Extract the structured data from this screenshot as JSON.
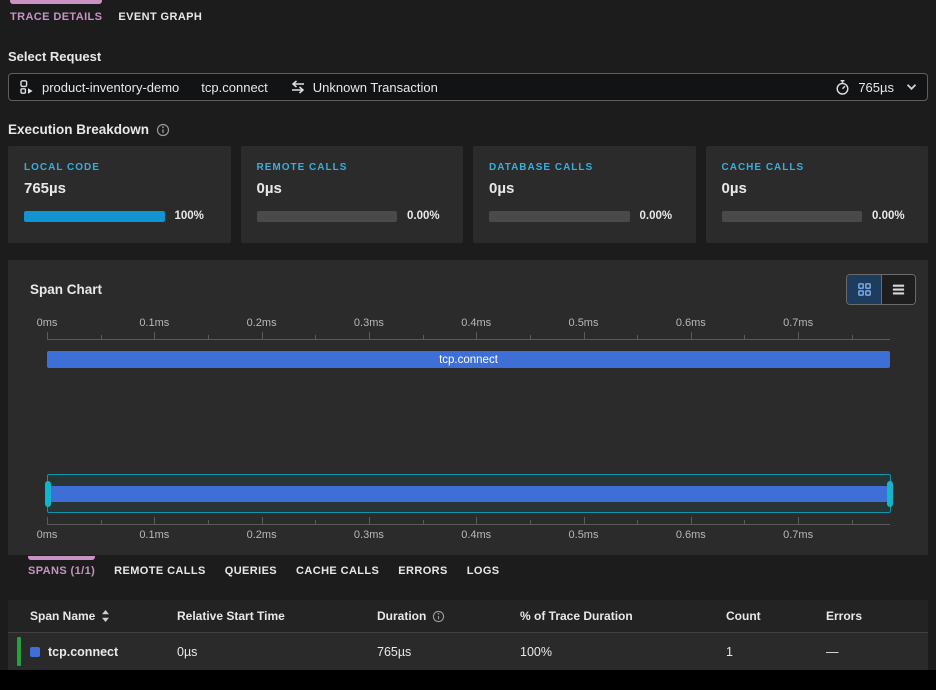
{
  "top_tabs": {
    "items": [
      {
        "label": "TRACE DETAILS",
        "active": true
      },
      {
        "label": "EVENT GRAPH",
        "active": false
      }
    ]
  },
  "select_request": {
    "heading": "Select Request",
    "service_name": "product-inventory-demo",
    "span_name": "tcp.connect",
    "transaction_name": "Unknown Transaction",
    "trace_duration": "765µs"
  },
  "execution_breakdown": {
    "heading": "Execution Breakdown",
    "cards": [
      {
        "label": "LOCAL CODE",
        "value": "765µs",
        "percent": "100%",
        "fill_pct": 100
      },
      {
        "label": "REMOTE CALLS",
        "value": "0µs",
        "percent": "0.00%",
        "fill_pct": 0
      },
      {
        "label": "DATABASE CALLS",
        "value": "0µs",
        "percent": "0.00%",
        "fill_pct": 0
      },
      {
        "label": "CACHE CALLS",
        "value": "0µs",
        "percent": "0.00%",
        "fill_pct": 0
      }
    ]
  },
  "span_chart": {
    "title": "Span Chart",
    "axis_labels": [
      "0ms",
      "0.1ms",
      "0.2ms",
      "0.3ms",
      "0.4ms",
      "0.5ms",
      "0.6ms",
      "0.7ms"
    ],
    "bar_label": "tcp.connect",
    "bar_duration": "765µs",
    "selection": "full-range"
  },
  "lower_tabs": {
    "items": [
      {
        "label": "SPANS (1/1)",
        "active": true
      },
      {
        "label": "REMOTE CALLS",
        "active": false
      },
      {
        "label": "QUERIES",
        "active": false
      },
      {
        "label": "CACHE CALLS",
        "active": false
      },
      {
        "label": "ERRORS",
        "active": false
      },
      {
        "label": "LOGS",
        "active": false
      }
    ]
  },
  "spans_table": {
    "columns": {
      "span_name": "Span Name",
      "relative_start_time": "Relative Start Time",
      "duration": "Duration",
      "pct_of_trace": "% of Trace Duration",
      "count": "Count",
      "errors": "Errors"
    },
    "rows": [
      {
        "span_name": "tcp.connect",
        "relative_start_time": "0µs",
        "duration": "765µs",
        "pct_of_trace": "100%",
        "count": "1",
        "errors": "—"
      }
    ]
  },
  "colors": {
    "accent_pink": "#c893c4",
    "accent_cyan": "#38aede",
    "progress_fill": "#1095d2",
    "span_bar_blue": "#3e6fd6",
    "brush_teal": "#12b5cb",
    "row_status_green": "#23a33a"
  }
}
